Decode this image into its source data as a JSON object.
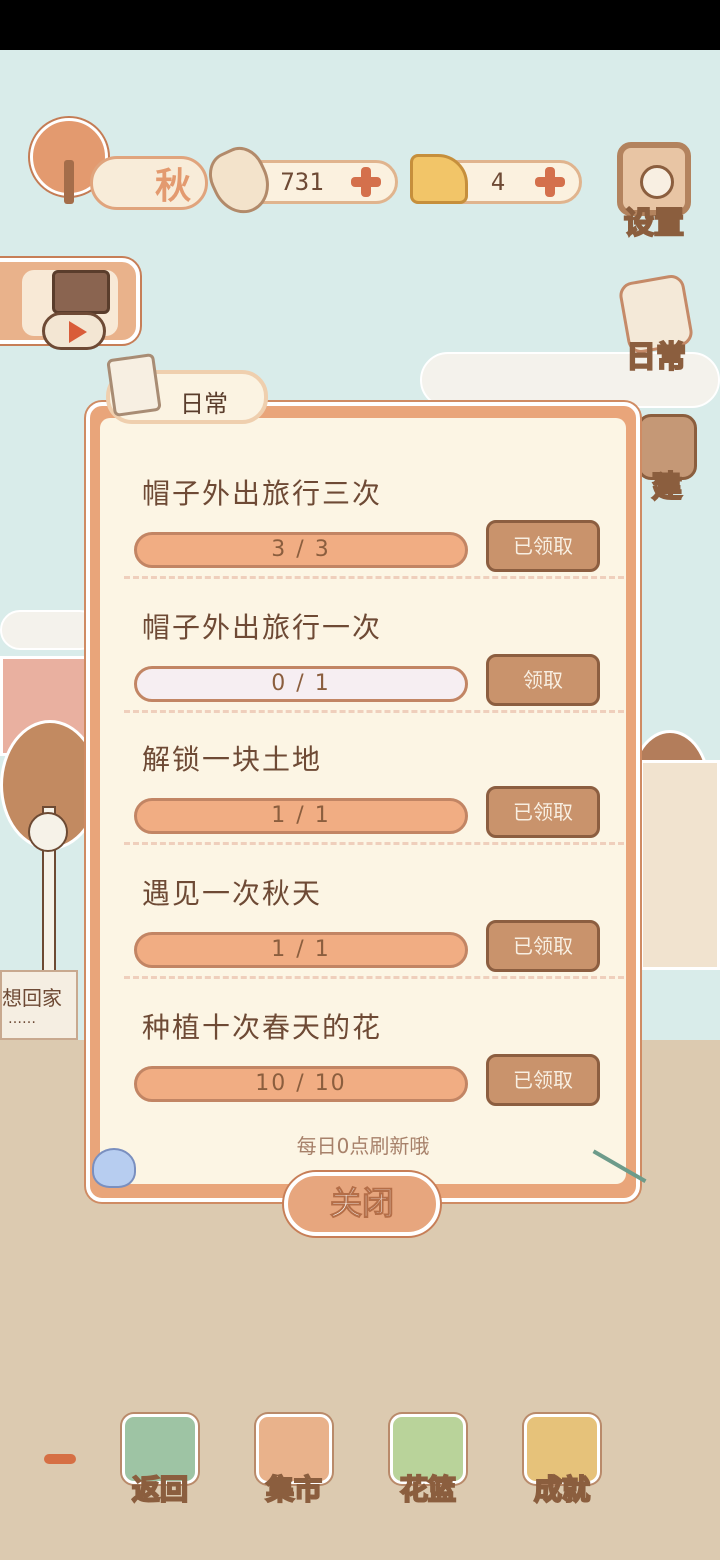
{
  "season": {
    "label": "秋"
  },
  "currencies": {
    "fish": {
      "value": "731"
    },
    "cheese": {
      "value": "4"
    }
  },
  "side_buttons": {
    "settings": "设置",
    "daily": "日常",
    "build": "建"
  },
  "scene": {
    "leave_home_label": "想回家",
    "leave_home_dots": "……"
  },
  "dialog": {
    "title": "日常",
    "tasks": [
      {
        "title": "帽子外出旅行三次",
        "progress": "3 / 3",
        "fraction": 1.0,
        "button": "已领取"
      },
      {
        "title": "帽子外出旅行一次",
        "progress": "0 / 1",
        "fraction": 0.0,
        "button": "领取"
      },
      {
        "title": "解锁一块土地",
        "progress": "1 / 1",
        "fraction": 1.0,
        "button": "已领取"
      },
      {
        "title": "遇见一次秋天",
        "progress": "1 / 1",
        "fraction": 1.0,
        "button": "已领取"
      },
      {
        "title": "种植十次春天的花",
        "progress": "10 / 10",
        "fraction": 1.0,
        "button": "已领取"
      }
    ],
    "refresh_note": "每日0点刷新哦",
    "close_label": "关闭"
  },
  "nav": [
    {
      "label": "返回",
      "icon": "window-icon",
      "color": "#9ec4a4"
    },
    {
      "label": "集市",
      "icon": "market-stall-icon",
      "color": "#e9b28b"
    },
    {
      "label": "花篮",
      "icon": "flower-basket-icon",
      "color": "#b9d39a"
    },
    {
      "label": "成就",
      "icon": "trophy-icon",
      "color": "#e6c27a"
    }
  ]
}
